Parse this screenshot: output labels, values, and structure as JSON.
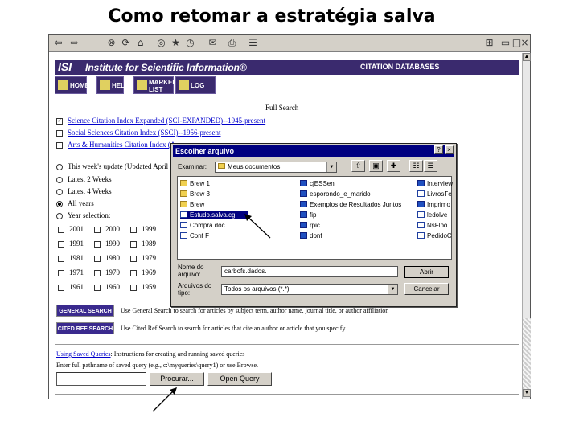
{
  "slide_title": "Como retomar a estratégia salva",
  "browser": {
    "toolbar_icons": [
      "back-icon",
      "forward-icon",
      "stop-icon",
      "refresh-icon",
      "home-icon",
      "search-icon",
      "favorites-icon",
      "history-icon",
      "mail-icon",
      "print-icon"
    ],
    "isi": {
      "logo": "ISI",
      "name": "Institute for Scientific Information®",
      "citation_databases": "CITATION DATABASES"
    },
    "nav": {
      "home": "HOME",
      "help": "HELP",
      "marked_list": "MARKED LIST",
      "logoff": "LOG OFF"
    },
    "full_search": "Full Search",
    "databases": [
      {
        "label": "Science Citation Index Expanded (SCI-EXPANDED)--1945-present",
        "checked": true
      },
      {
        "label": "Social Sciences Citation Index (SSCI)--1956-present",
        "checked": false
      },
      {
        "label": "Arts & Humanities Citation Index (A",
        "checked": false
      }
    ],
    "timespan": [
      {
        "label": "This week's update (Updated April",
        "selected": false
      },
      {
        "label": "Latest 2 Weeks",
        "selected": false
      },
      {
        "label": "Latest 4 Weeks",
        "selected": false
      },
      {
        "label": "All years",
        "selected": true
      },
      {
        "label": "Year selection:",
        "selected": false
      }
    ],
    "years": [
      [
        "2001",
        "2000",
        "1999"
      ],
      [
        "1991",
        "1990",
        "1989"
      ],
      [
        "1981",
        "1980",
        "1979"
      ],
      [
        "1971",
        "1970",
        "1969"
      ],
      [
        "1961",
        "1960",
        "1959"
      ]
    ],
    "general_search": {
      "button": "GENERAL SEARCH",
      "desc": "Use General Search to search for articles by subject term, author name, journal title, or author affiliation"
    },
    "cited_ref_search": {
      "button": "CITED REF SEARCH",
      "desc": "Use Cited Ref Search to search for articles that cite an author or article that you specify"
    },
    "saved_queries": {
      "link": "Using Saved Queries",
      "link_desc": ": Instructions for creating and running saved queries",
      "instruction": "Enter full pathname of saved query (e.g., c:\\myqueries\\query1) or use Browse.",
      "path_value": "",
      "browse_button": "Procurar...",
      "open_button": "Open Query"
    }
  },
  "dialog": {
    "title": "Escolher arquivo",
    "look_in_label": "Examinar:",
    "look_in_value": "Meus documentos",
    "files_left": [
      {
        "name": "Brew 1",
        "type": "folder"
      },
      {
        "name": "Brew 3",
        "type": "folder"
      },
      {
        "name": "Brew",
        "type": "folder"
      },
      {
        "name": "Estudo.salva.cgi",
        "type": "doc",
        "selected": true
      },
      {
        "name": "Compra.doc",
        "type": "doc"
      },
      {
        "name": "Conf F",
        "type": "doc"
      }
    ],
    "files_mid": [
      {
        "name": "cjESSen",
        "type": "word"
      },
      {
        "name": "esporondo_e_marido",
        "type": "word"
      },
      {
        "name": "Exemplos de Resultados Juntos",
        "type": "word"
      },
      {
        "name": "fip",
        "type": "word"
      },
      {
        "name": "rpic",
        "type": "word"
      },
      {
        "name": "donf",
        "type": "word"
      }
    ],
    "files_right": [
      {
        "name": "Interview",
        "type": "word"
      },
      {
        "name": "LivrosFe",
        "type": "doc"
      },
      {
        "name": "Imprimo",
        "type": "word"
      },
      {
        "name": "ledolve",
        "type": "doc"
      },
      {
        "name": "NsFlpo",
        "type": "doc"
      },
      {
        "name": "PedidoC",
        "type": "doc"
      }
    ],
    "filename_label": "Nome do arquivo:",
    "filename_value": "carbofs.dados.",
    "filetype_label": "Arquivos do tipo:",
    "filetype_value": "Todos os arquivos (*.*)",
    "open_button": "Abrir",
    "cancel_button": "Cancelar"
  }
}
